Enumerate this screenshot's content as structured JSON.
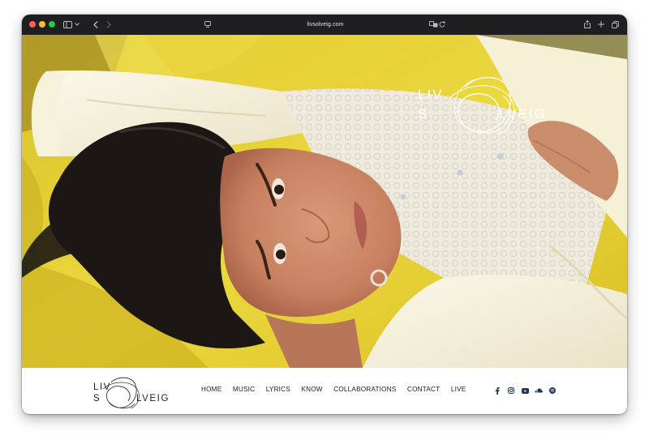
{
  "browser": {
    "url": "livsolveig.com"
  },
  "hero": {
    "logo_top": "LIV",
    "logo_bottom_left": "S",
    "logo_bottom_right": "LVEIG"
  },
  "nav": {
    "logo_top": "LIV",
    "logo_bottom_left": "S",
    "logo_bottom_right": "LVEIG",
    "items": [
      {
        "label": "HOME"
      },
      {
        "label": "MUSIC"
      },
      {
        "label": "LYRICS"
      },
      {
        "label": "KNOW"
      },
      {
        "label": "COLLABORATIONS"
      },
      {
        "label": "CONTACT"
      },
      {
        "label": "LIVE"
      }
    ],
    "social_icons": [
      "facebook-icon",
      "instagram-icon",
      "youtube-icon",
      "soundcloud-icon",
      "spotify-icon"
    ],
    "social_color": "#1c3a5a"
  },
  "colors": {
    "titlebar": "#1f1f21",
    "hero_yellow": "#e7d33a",
    "sweater": "#f4f0dc"
  }
}
